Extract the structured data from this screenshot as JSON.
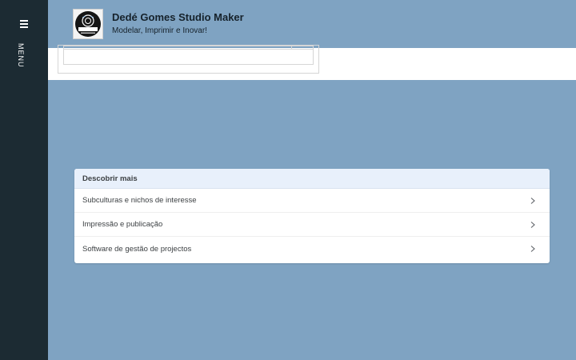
{
  "sidebar": {
    "menu_icon": "hamburger-menu-icon",
    "menu_label": "MENU"
  },
  "header": {
    "title": "Dedé Gomes Studio Maker",
    "tagline": "Modelar, Imprimir e Inovar!",
    "logo_text": "dedegomes"
  },
  "discover": {
    "title": "Descobrir mais",
    "items": [
      {
        "label": "Subculturas e nichos de interesse",
        "icon": "chevron-right-icon"
      },
      {
        "label": "Impressão e publicação",
        "icon": "chevron-right-icon"
      },
      {
        "label": "Software de gestão de projectos",
        "icon": "chevron-right-icon"
      }
    ]
  },
  "colors": {
    "page_background": "#7fa3c2",
    "sidebar_background": "#1c2b33",
    "card_header_background": "#e8f0fb"
  }
}
